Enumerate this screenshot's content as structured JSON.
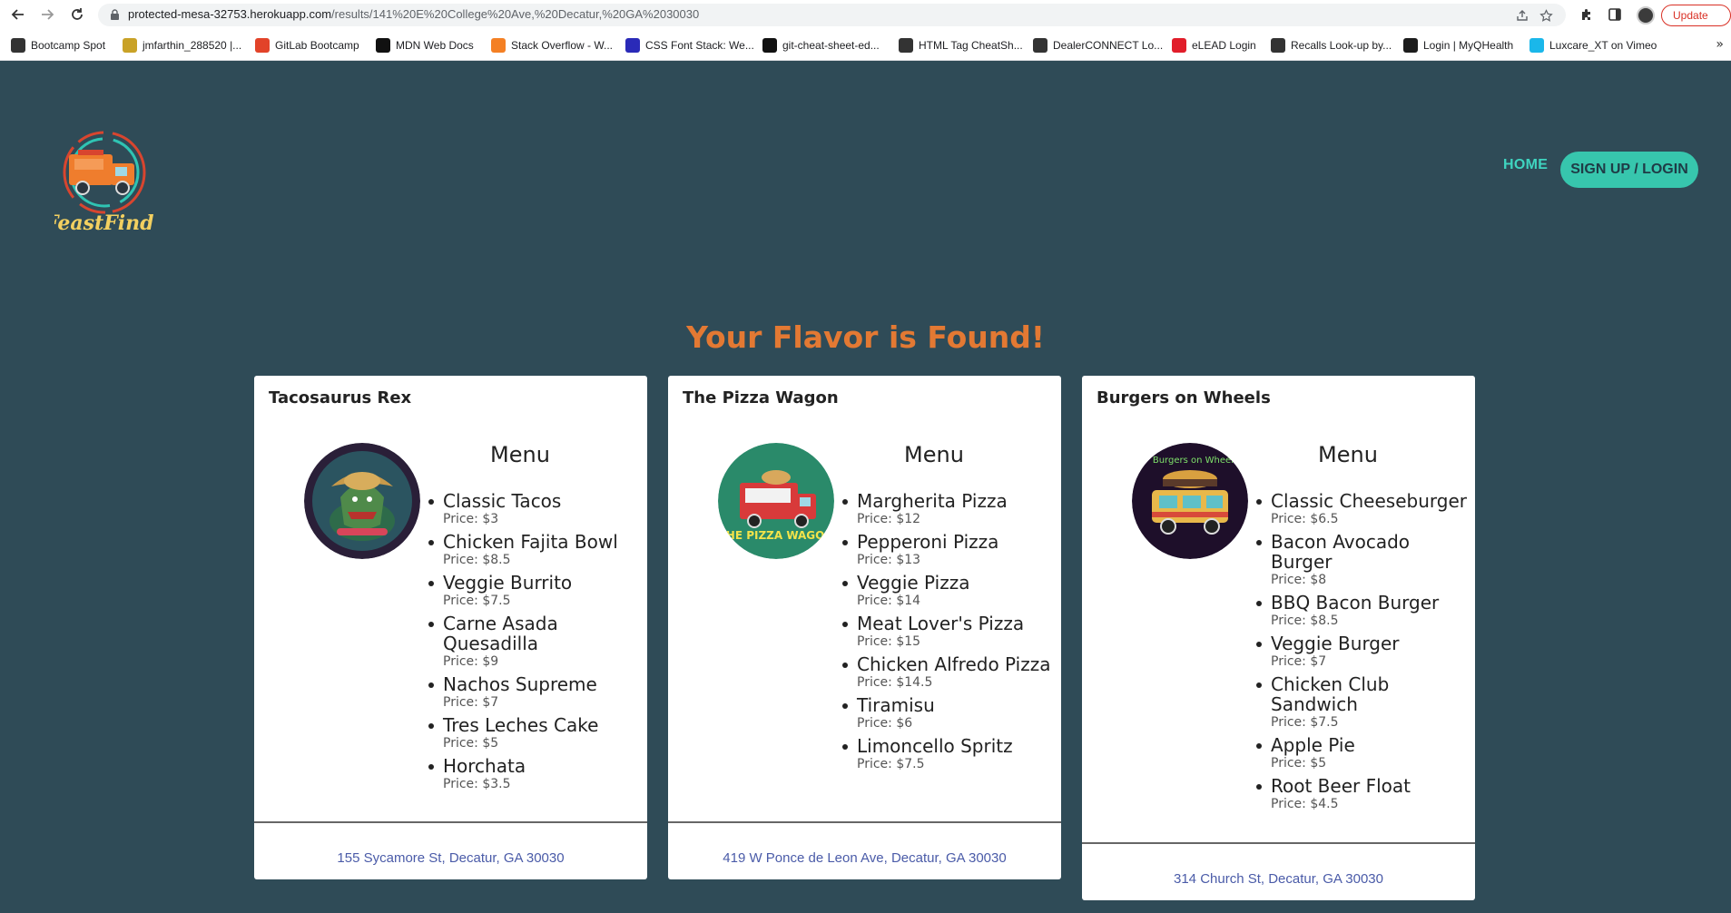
{
  "browser": {
    "url_host": "protected-mesa-32753.herokuapp.com",
    "url_path": "/results/141%20E%20College%20Ave,%20Decatur,%20GA%2030030",
    "update_label": "Update",
    "bookmarks": [
      {
        "label": "Bootcamp Spot",
        "icon": "globe-icon",
        "color": "#333333"
      },
      {
        "label": "jmfarthin_288520 |...",
        "icon": "bee-icon",
        "color": "#c9a227"
      },
      {
        "label": "GitLab Bootcamp",
        "icon": "gitlab-icon",
        "color": "#e24329"
      },
      {
        "label": "MDN Web Docs",
        "icon": "mdn-icon",
        "color": "#111111"
      },
      {
        "label": "Stack Overflow - W...",
        "icon": "stackoverflow-icon",
        "color": "#f48024"
      },
      {
        "label": "CSS Font Stack: We...",
        "icon": "cssfont-icon",
        "color": "#2a2ab8"
      },
      {
        "label": "git-cheat-sheet-ed...",
        "icon": "github-icon",
        "color": "#111111"
      },
      {
        "label": "HTML Tag CheatSh...",
        "icon": "globe-icon",
        "color": "#333333"
      },
      {
        "label": "DealerCONNECT Lo...",
        "icon": "globe-icon",
        "color": "#333333"
      },
      {
        "label": "eLEAD Login",
        "icon": "elead-icon",
        "color": "#e11d2a"
      },
      {
        "label": "Recalls Look-up by...",
        "icon": "globe-icon",
        "color": "#333333"
      },
      {
        "label": "Login | MyQHealth",
        "icon": "myq-icon",
        "color": "#1c1c1c"
      },
      {
        "label": "Luxcare_XT on Vimeo",
        "icon": "vimeo-icon",
        "color": "#1ab7ea"
      }
    ],
    "more_bookmarks": "»"
  },
  "site": {
    "logo_text": "FeastFindr",
    "nav_home": "HOME",
    "nav_signup": "SIGN UP / LOGIN",
    "headline": "Your Flavor is Found!"
  },
  "colors": {
    "page_bg": "#2f4b57",
    "accent_teal": "#37c6ad",
    "headline_orange": "#e37933",
    "address_blue": "#4a5ba8"
  },
  "trucks": [
    {
      "name": "Tacosaurus Rex",
      "image_icon": "tacosaurus-logo-icon",
      "menu_title": "Menu",
      "items": [
        {
          "name": "Classic Tacos",
          "price": "Price: $3"
        },
        {
          "name": "Chicken Fajita Bowl",
          "price": "Price: $8.5"
        },
        {
          "name": "Veggie Burrito",
          "price": "Price: $7.5"
        },
        {
          "name": "Carne Asada Quesadilla",
          "price": "Price: $9"
        },
        {
          "name": "Nachos Supreme",
          "price": "Price: $7"
        },
        {
          "name": "Tres Leches Cake",
          "price": "Price: $5"
        },
        {
          "name": "Horchata",
          "price": "Price: $3.5"
        }
      ],
      "address": "155 Sycamore St, Decatur, GA 30030"
    },
    {
      "name": "The Pizza Wagon",
      "image_icon": "pizza-wagon-logo-icon",
      "image_text": "THE PIZZA WAGON",
      "menu_title": "Menu",
      "items": [
        {
          "name": "Margherita Pizza",
          "price": "Price: $12"
        },
        {
          "name": "Pepperoni Pizza",
          "price": "Price: $13"
        },
        {
          "name": "Veggie Pizza",
          "price": "Price: $14"
        },
        {
          "name": "Meat Lover's Pizza",
          "price": "Price: $15"
        },
        {
          "name": "Chicken Alfredo Pizza",
          "price": "Price: $14.5"
        },
        {
          "name": "Tiramisu",
          "price": "Price: $6"
        },
        {
          "name": "Limoncello Spritz",
          "price": "Price: $7.5"
        }
      ],
      "address": "419 W Ponce de Leon Ave, Decatur, GA 30030"
    },
    {
      "name": "Burgers on Wheels",
      "image_icon": "burgers-on-wheels-logo-icon",
      "image_text": "Burgers on Wheels",
      "menu_title": "Menu",
      "items": [
        {
          "name": "Classic Cheeseburger",
          "price": "Price: $6.5"
        },
        {
          "name": "Bacon Avocado Burger",
          "price": "Price: $8"
        },
        {
          "name": "BBQ Bacon Burger",
          "price": "Price: $8.5"
        },
        {
          "name": "Veggie Burger",
          "price": "Price: $7"
        },
        {
          "name": "Chicken Club Sandwich",
          "price": "Price: $7.5"
        },
        {
          "name": "Apple Pie",
          "price": "Price: $5"
        },
        {
          "name": "Root Beer Float",
          "price": "Price: $4.5"
        }
      ],
      "address": "314 Church St, Decatur, GA 30030"
    }
  ]
}
